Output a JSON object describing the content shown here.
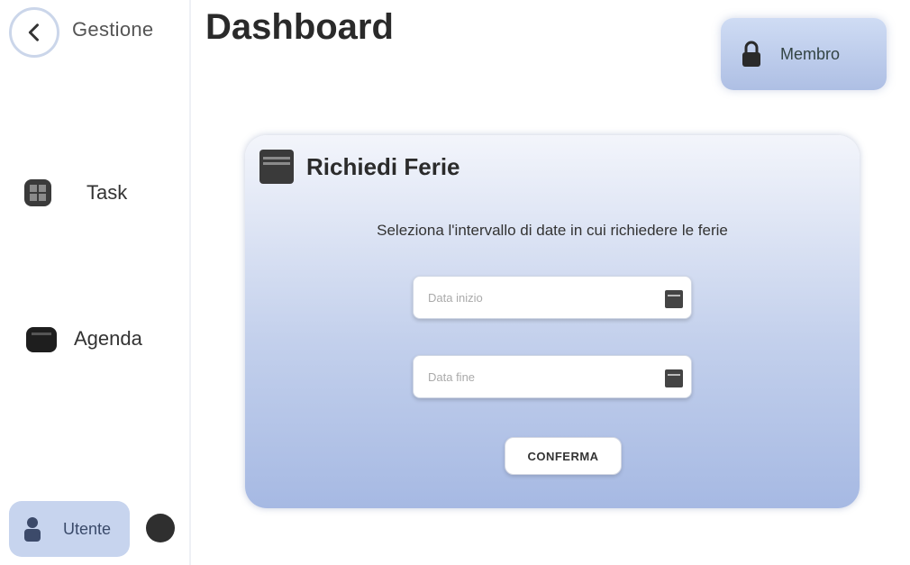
{
  "app": {
    "brand": "Gestione"
  },
  "header": {
    "title": "Dashboard",
    "member_label": "Membro"
  },
  "sidebar": {
    "items": [
      {
        "label": "Task",
        "icon": "grid-icon"
      },
      {
        "label": "Agenda",
        "icon": "calendar-icon"
      }
    ],
    "user_label": "Utente"
  },
  "card": {
    "title": "Richiedi Ferie",
    "subtitle": "Seleziona l'intervallo di date in cui richiedere le ferie",
    "start_placeholder": "Data inizio",
    "end_placeholder": "Data fine",
    "confirm_label": "CONFERMA"
  },
  "colors": {
    "accent": "#aebfe4",
    "card_gradient_top": "#f3f5fb",
    "card_gradient_bottom": "#a6b9e3"
  }
}
